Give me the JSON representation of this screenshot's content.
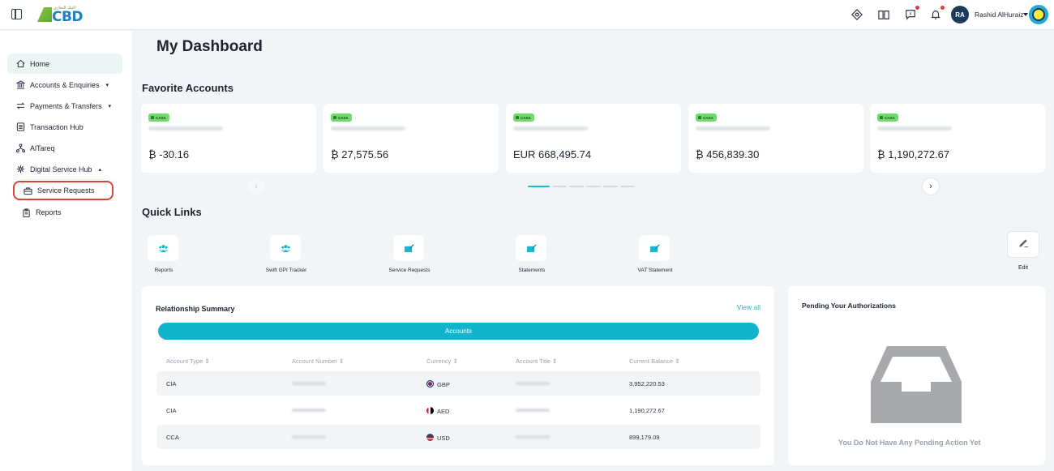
{
  "header": {
    "logo_text": "CBD",
    "logo_subtext": "البنك التجاري",
    "user_initials": "RA",
    "user_name": "Rashid AlHuraiz"
  },
  "sidebar": {
    "items": [
      {
        "label": "Home",
        "icon": "home-icon"
      },
      {
        "label": "Accounts & Enquiries",
        "icon": "bank-icon",
        "caret": "▾"
      },
      {
        "label": "Payments & Transfers",
        "icon": "transfer-icon",
        "caret": "▾"
      },
      {
        "label": "Transaction Hub",
        "icon": "list-icon"
      },
      {
        "label": "AlTareq",
        "icon": "network-icon"
      },
      {
        "label": "Digital Service Hub",
        "icon": "hub-icon",
        "caret": "▴"
      }
    ],
    "subitems": [
      {
        "label": "Service Requests",
        "icon": "briefcase-icon"
      },
      {
        "label": "Reports",
        "icon": "clipboard-icon"
      }
    ]
  },
  "main": {
    "title": "My Dashboard",
    "favorites": {
      "title": "Favorite Accounts",
      "cards": [
        {
          "tag": "CASA",
          "balance": "₿ -30.16"
        },
        {
          "tag": "CASA",
          "balance": "₿ 27,575.56"
        },
        {
          "tag": "CASA",
          "balance": "EUR 668,495.74"
        },
        {
          "tag": "CASA",
          "balance": "₿ 456,839.30"
        },
        {
          "tag": "CASA",
          "balance": "₿ 1,190,272.67"
        }
      ],
      "prev_arrow": "‹",
      "next_arrow": "›"
    },
    "quick_links": {
      "title": "Quick Links",
      "items": [
        "Reports",
        "Swift GPI Tracker",
        "Service Requests",
        "Statements",
        "VAT Statement"
      ],
      "edit_label": "Edit"
    },
    "relationship_summary": {
      "title": "Relationship Summary",
      "view_all": "View all",
      "tab": "Accounts",
      "columns": [
        "Account Type ⇕",
        "Account Number ⇕",
        "Currency ⇕",
        "Account Title ⇕",
        "Current Balance ⇕"
      ],
      "rows": [
        {
          "type": "CIA",
          "currency": "GBP",
          "balance": "3,952,220.53"
        },
        {
          "type": "CIA",
          "currency": "AED",
          "balance": "1,190,272.67"
        },
        {
          "type": "CCA",
          "currency": "USD",
          "balance": "899,179.09"
        }
      ]
    },
    "pending": {
      "title": "Pending Your Authorizations",
      "empty_text": "You Do Not Have Any Pending Action Yet"
    }
  },
  "colors": {
    "accent": "#12b3cc",
    "highlight": "#d7453a",
    "casa_tag": "#6fdb6a"
  }
}
